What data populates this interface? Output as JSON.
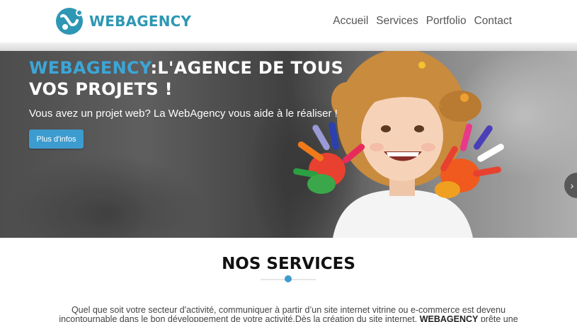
{
  "header": {
    "logo_icon": "webagency-logo-icon",
    "logo_text": "WEBAGENCY",
    "brand_color": "#2e97b4",
    "nav": [
      {
        "label": "Accueil"
      },
      {
        "label": "Services"
      },
      {
        "label": "Portfolio"
      },
      {
        "label": "Contact"
      }
    ]
  },
  "hero": {
    "title_brand": "WEBAGENCY",
    "title_rest_line1": ":L'AGENCE DE TOUS",
    "title_line2": "VOS PROJETS !",
    "subtitle": "Vous avez un projet web? La WebAgency vous aide à le réaliser !",
    "button_label": "Plus d'infos",
    "next_icon": "chevron-right-icon",
    "accent_color": "#3ca6d8"
  },
  "services": {
    "title": "NOS SERVICES",
    "text_line1": "Quel que soit votre secteur d'activité, communiquer à partir d’un site internet vitrine ou e-commerce est devenu",
    "text_line2_a": "incontournable dans le bon développement de votre activité.Dès la création du site internet,",
    "text_line2_brand": "WEBAGENCY",
    "text_line2_b": "prête une"
  }
}
